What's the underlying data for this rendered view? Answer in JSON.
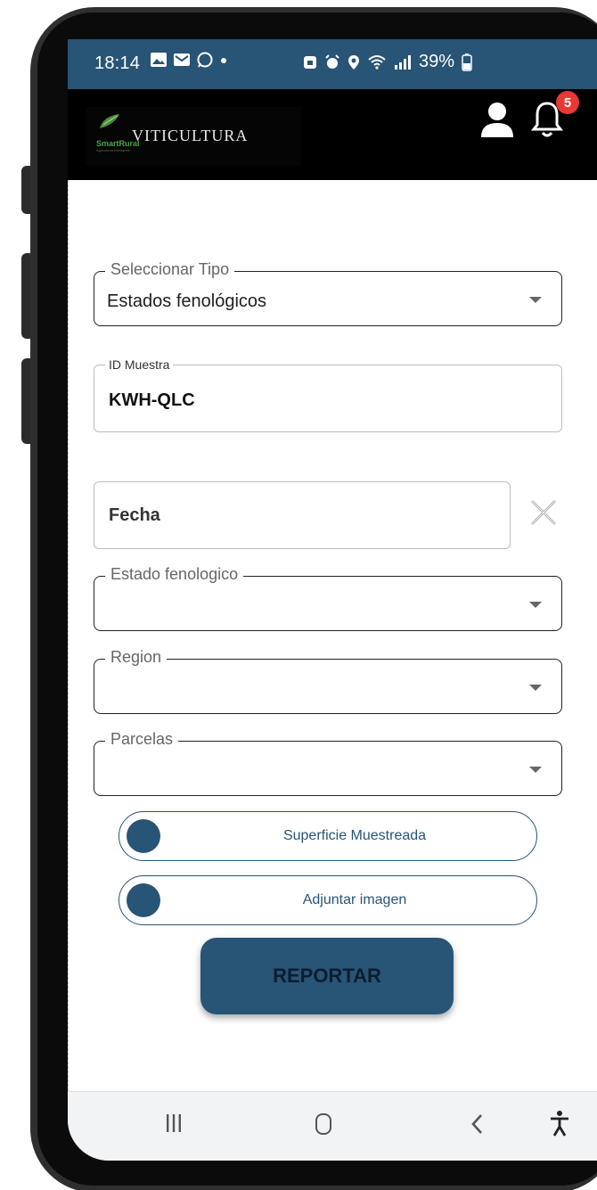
{
  "status_bar": {
    "time": "18:14",
    "battery": "39%",
    "background": "#285476"
  },
  "header": {
    "logo_title": "VITICULTURA",
    "logo_brand": "SmartRural",
    "logo_tagline": "Agricultura inteligente",
    "notification_count": "5"
  },
  "form": {
    "tipo": {
      "legend": "Seleccionar Tipo",
      "value": "Estados fenológicos"
    },
    "id_muestra": {
      "legend": "ID Muestra",
      "value": "KWH-QLC"
    },
    "fecha": {
      "value": "Fecha"
    },
    "estado": {
      "legend": "Estado fenologico",
      "value": ""
    },
    "region": {
      "legend": "Region",
      "value": ""
    },
    "parcelas": {
      "legend": "Parcelas",
      "value": ""
    }
  },
  "toggles": [
    {
      "label": "Superficie Muestreada",
      "on": false
    },
    {
      "label": "Adjuntar imagen",
      "on": false
    }
  ],
  "actions": {
    "report_label": "REPORTAR"
  },
  "colors": {
    "primary": "#285476",
    "badge": "#e53935",
    "brand_green": "#49a343"
  }
}
